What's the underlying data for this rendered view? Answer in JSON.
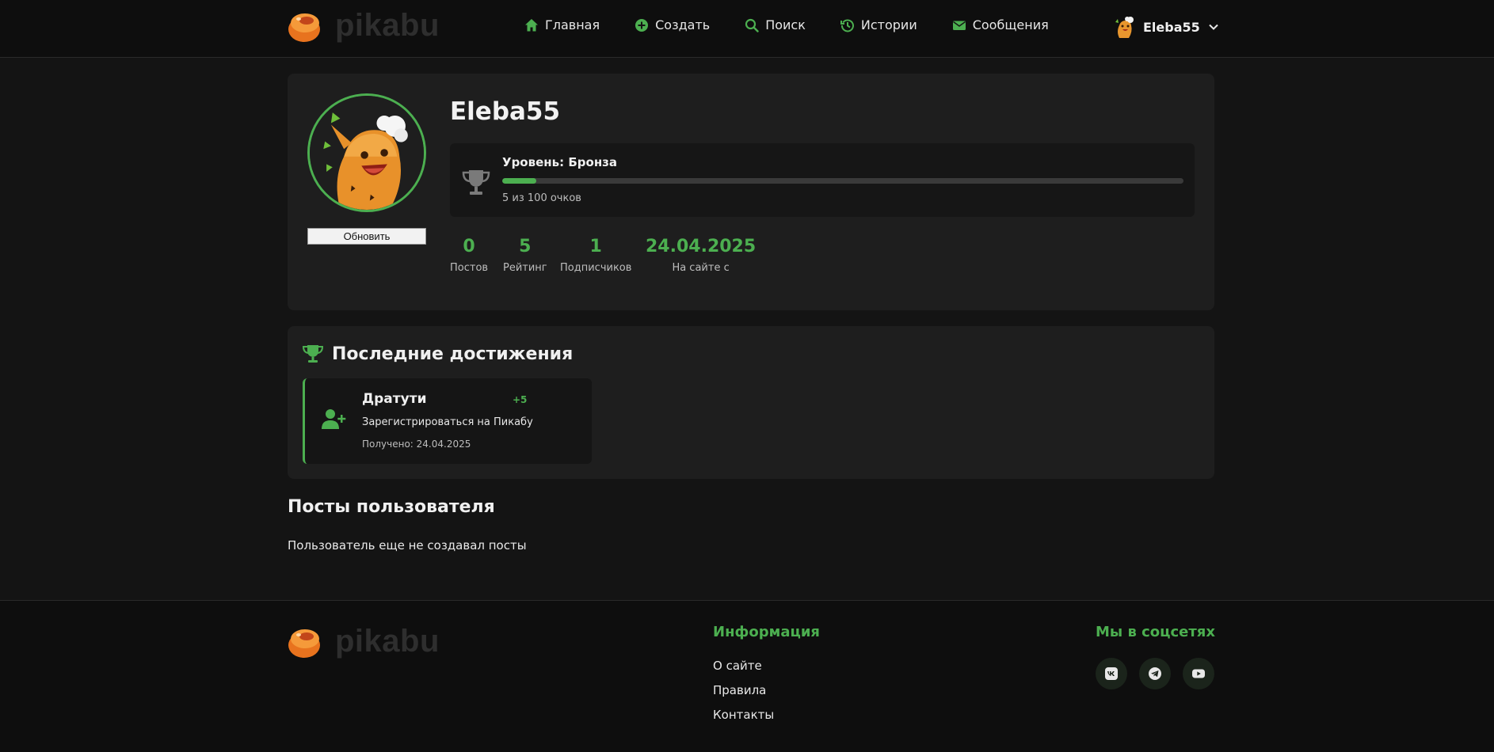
{
  "header": {
    "logo_text": "pikabu",
    "nav": [
      {
        "label": "Главная",
        "icon": "home-icon"
      },
      {
        "label": "Создать",
        "icon": "plus-circle-icon"
      },
      {
        "label": "Поиск",
        "icon": "search-icon"
      },
      {
        "label": "Истории",
        "icon": "history-icon"
      },
      {
        "label": "Сообщения",
        "icon": "envelope-icon"
      }
    ],
    "user": {
      "name": "Eleba55",
      "icon": "chevron-down-icon"
    }
  },
  "profile": {
    "username": "Eleba55",
    "refresh_label": "Обновить",
    "level": {
      "title": "Уровень: Бронза",
      "points_text": "5 из 100 очков",
      "progress_percent": 5,
      "icon": "trophy-icon"
    },
    "stats": [
      {
        "value": "0",
        "label": "Постов"
      },
      {
        "value": "5",
        "label": "Рейтинг"
      },
      {
        "value": "1",
        "label": "Подписчиков"
      },
      {
        "value": "24.04.2025",
        "label": "На сайте с"
      }
    ]
  },
  "achievements": {
    "title": "Последние достижения",
    "icon": "trophy-icon",
    "items": [
      {
        "name": "Дратути",
        "points": "+5",
        "description": "Зарегистрироваться на Пикабу",
        "date": "Получено: 24.04.2025",
        "icon": "user-plus-icon"
      }
    ]
  },
  "posts": {
    "title": "Посты пользователя",
    "empty_text": "Пользователь еще не создавал посты"
  },
  "footer": {
    "logo_text": "pikabu",
    "info_title": "Информация",
    "links": [
      "О сайте",
      "Правила",
      "Контакты"
    ],
    "social_title": "Мы в соцсетях",
    "social": [
      "vk-icon",
      "telegram-icon",
      "youtube-icon"
    ]
  },
  "colors": {
    "accent": "#4caf50",
    "background": "#141414",
    "card": "#1e1e1e",
    "header": "#0e0e0e"
  }
}
